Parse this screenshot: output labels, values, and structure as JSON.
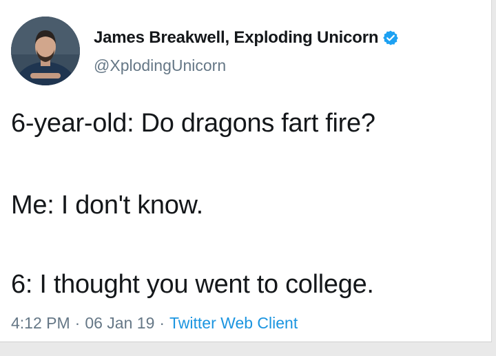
{
  "tweet": {
    "display_name": "James Breakwell, Exploding Unicorn",
    "verified": true,
    "handle": "@XplodingUnicorn",
    "lines": [
      "6-year-old: Do dragons fart fire?",
      "Me: I don't know.",
      "6: I thought you went to college."
    ],
    "time": "4:12 PM",
    "date": "06 Jan 19",
    "separator": "·",
    "client": "Twitter Web Client"
  },
  "colors": {
    "name_text": "#14171a",
    "secondary_text": "#657786",
    "link": "#1b95e0",
    "verified_badge": "#1da1f2"
  },
  "icons": {
    "verified": "verified-badge-icon",
    "avatar": "profile-photo"
  }
}
